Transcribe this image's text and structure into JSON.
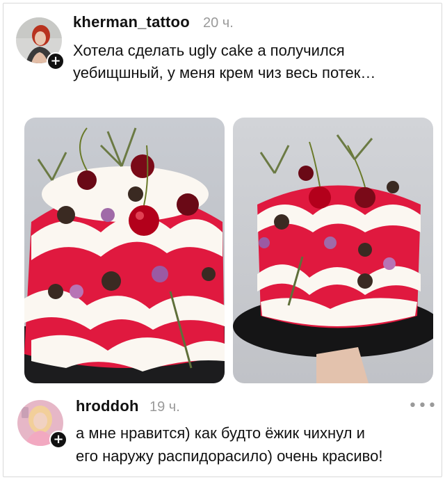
{
  "post": {
    "username": "kherman_tattoo",
    "time": "20 ч.",
    "text_line1": "Хотела сделать ugly cake а получился",
    "text_line2": "уебищшный, у меня крем чиз весь потек…",
    "photos": [
      {
        "alt": "cake-photo-left"
      },
      {
        "alt": "cake-photo-right"
      }
    ]
  },
  "reply": {
    "username": "hroddoh",
    "time": "19 ч.",
    "text_line1": "а мне нравится) как будто ёжик чихнул и",
    "text_line2": "его наружу распидорасило) очень красиво!",
    "more_label": "•••"
  },
  "icons": {
    "follow": "plus-icon",
    "more": "more-icon"
  },
  "colors": {
    "text": "#111111",
    "muted": "#9a9a9a",
    "cake_red": "#e0193f",
    "cream": "#fbf7f1"
  }
}
